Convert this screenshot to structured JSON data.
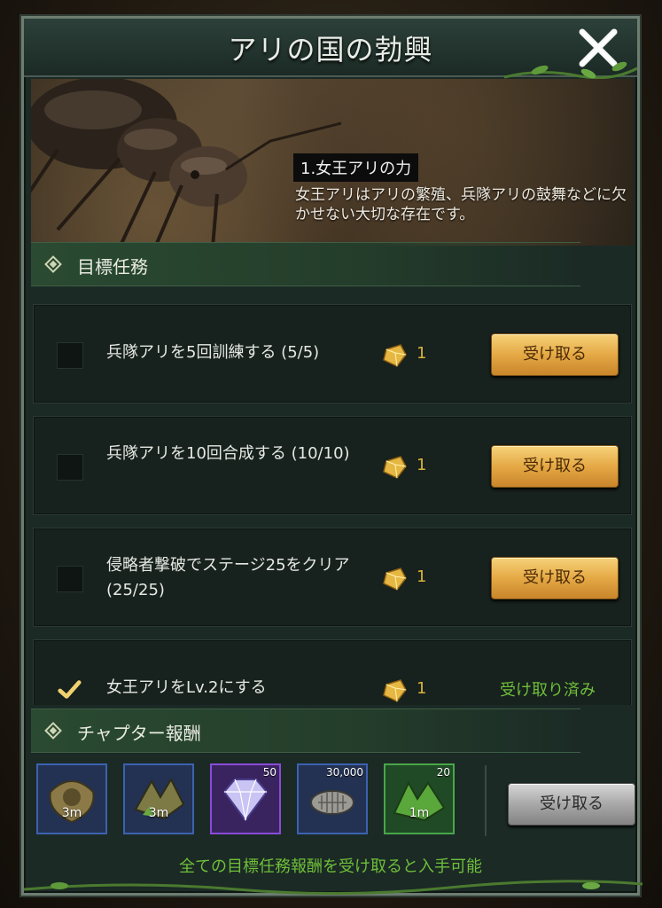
{
  "header": {
    "title": "アリの国の勃興",
    "close_icon": "close-x-icon"
  },
  "banner": {
    "chapter_title": "1.女王アリの力",
    "description": "女王アリはアリの繁殖、兵隊アリの鼓舞などに欠かせない大切な存在です。"
  },
  "tasks_section": {
    "label": "目標任務"
  },
  "tasks": [
    {
      "text": "兵隊アリを5回訓練する (5/5)",
      "reward_icon": "gold-gem-icon",
      "reward_count": "1",
      "button": "受け取る",
      "checked": false
    },
    {
      "text": "兵隊アリを10回合成する (10/10)",
      "reward_icon": "gold-gem-icon",
      "reward_count": "1",
      "button": "受け取る",
      "checked": false
    },
    {
      "text": "侵略者撃破でステージ25をクリア (25/25)",
      "reward_icon": "gold-gem-icon",
      "reward_count": "1",
      "button": "受け取る",
      "checked": false
    },
    {
      "text": "女王アリをLv.2にする",
      "reward_icon": "gold-gem-icon",
      "reward_count": "1",
      "status": "受け取り済み",
      "checked": true
    }
  ],
  "chapter_section": {
    "label": "チャプター報酬"
  },
  "chapter_rewards": [
    {
      "icon": "speedup-food-icon",
      "timer": "3m",
      "rarity": "blue"
    },
    {
      "icon": "speedup-arrow-icon",
      "timer": "3m",
      "rarity": "blue"
    },
    {
      "icon": "diamond-icon",
      "qty": "50",
      "rarity": "purple"
    },
    {
      "icon": "pillbug-icon",
      "qty": "30,000",
      "rarity": "blue"
    },
    {
      "icon": "speedup-green-icon",
      "qty": "20",
      "timer": "1m",
      "rarity": "green"
    }
  ],
  "chapter_claim": {
    "button": "受け取る"
  },
  "unlock_note": "全ての目標任務報酬を受け取ると入手可能",
  "colors": {
    "gold_button": "#e5a945",
    "claimed_green": "#6fbf3a",
    "panel": "#1b2a25"
  }
}
